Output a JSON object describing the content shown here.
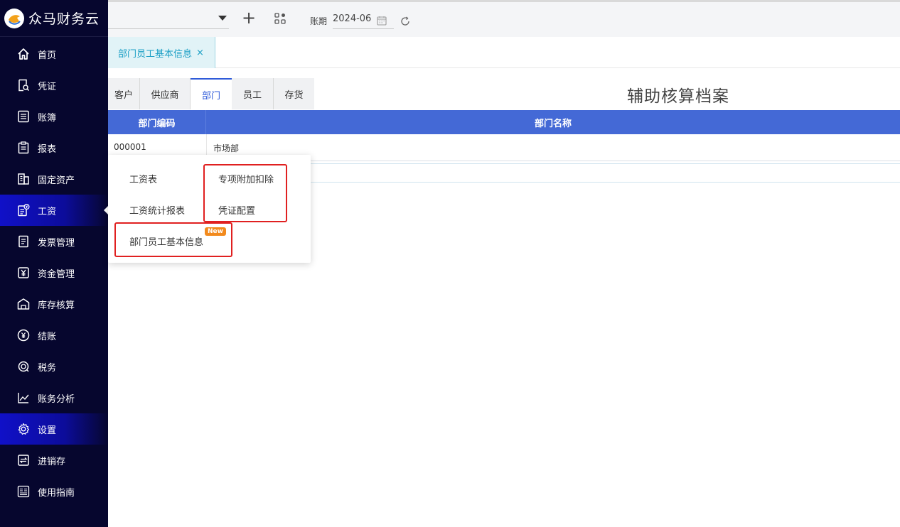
{
  "app": {
    "name": "众马财务云"
  },
  "sidebar": {
    "items": [
      {
        "label": "首页",
        "icon": "home-icon"
      },
      {
        "label": "凭证",
        "icon": "voucher-icon"
      },
      {
        "label": "账簿",
        "icon": "ledger-icon"
      },
      {
        "label": "报表",
        "icon": "report-icon"
      },
      {
        "label": "固定资产",
        "icon": "building-icon"
      },
      {
        "label": "工资",
        "icon": "salary-icon",
        "active": true
      },
      {
        "label": "发票管理",
        "icon": "invoice-icon"
      },
      {
        "label": "资金管理",
        "icon": "yen-icon"
      },
      {
        "label": "库存核算",
        "icon": "warehouse-icon"
      },
      {
        "label": "结账",
        "icon": "close-account-icon"
      },
      {
        "label": "税务",
        "icon": "tax-icon"
      },
      {
        "label": "账务分析",
        "icon": "chart-icon"
      },
      {
        "label": "设置",
        "icon": "gear-icon",
        "active": true
      },
      {
        "label": "进销存",
        "icon": "inventory-icon"
      },
      {
        "label": "使用指南",
        "icon": "guide-icon"
      }
    ]
  },
  "topbar": {
    "period_label": "账期",
    "period_value": "2024-06"
  },
  "tabs": {
    "open": [
      {
        "label": "部门员工基本信息",
        "close": "×"
      }
    ]
  },
  "subtabs": [
    {
      "label": "客户"
    },
    {
      "label": "供应商"
    },
    {
      "label": "部门",
      "active": true
    },
    {
      "label": "员工"
    },
    {
      "label": "存货"
    }
  ],
  "page": {
    "title": "辅助核算档案"
  },
  "table": {
    "headers": [
      "部门编码",
      "部门名称"
    ],
    "rows": [
      [
        "000001",
        "市场部"
      ]
    ]
  },
  "flyout": {
    "items": {
      "salary_table": "工资表",
      "special_deduction": "专项附加扣除",
      "salary_stats": "工资统计报表",
      "voucher_config": "凭证配置",
      "dept_employee_info": "部门员工基本信息"
    },
    "badge": "New"
  },
  "colors": {
    "sidebar_bg": "#06062e",
    "accent_blue": "#4469d6",
    "tab_teal": "#1a9fc5",
    "highlight_red": "#e02020",
    "badge_orange": "#f28a1d"
  }
}
